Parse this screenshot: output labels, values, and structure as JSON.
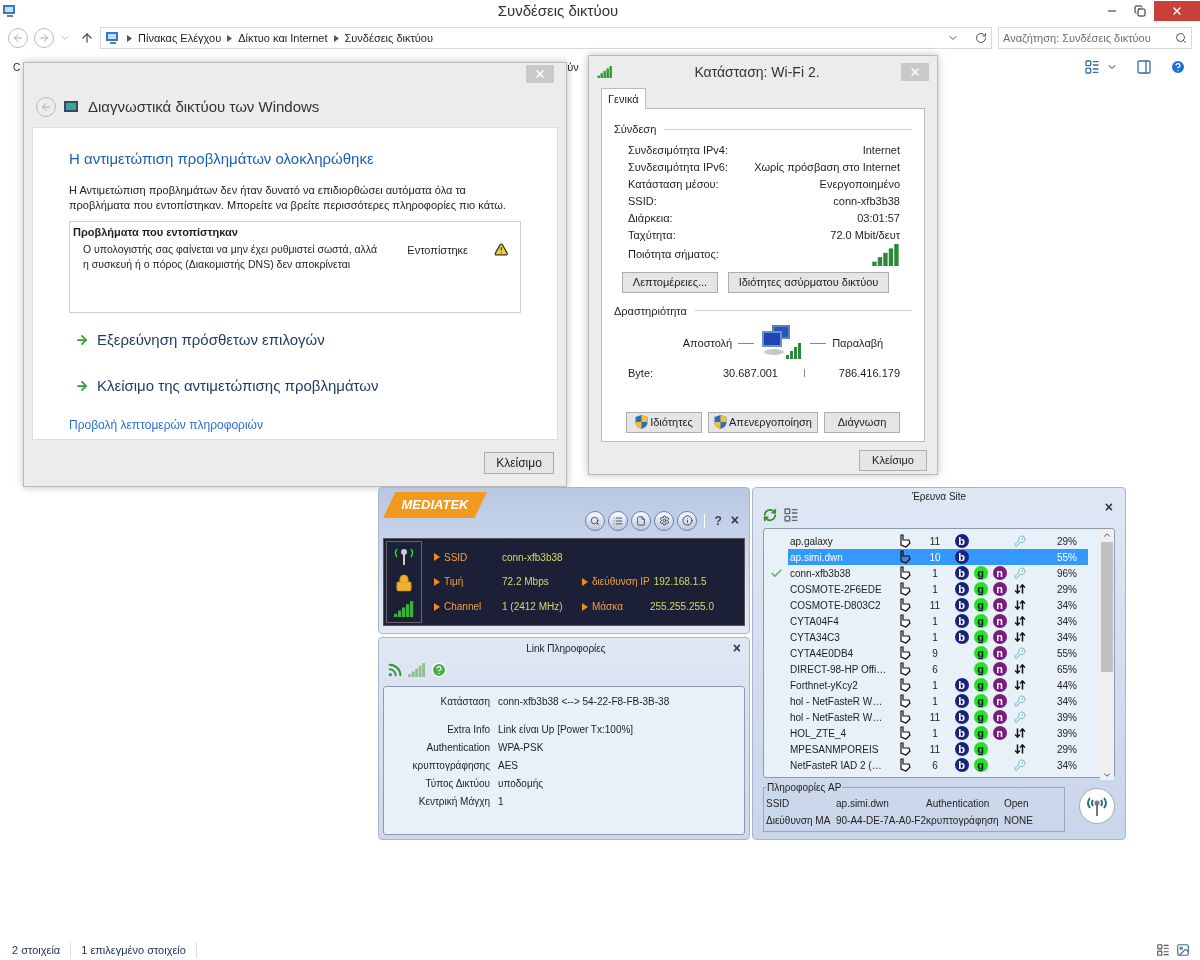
{
  "explorer": {
    "title": "Συνδέσεις δικτύου",
    "breadcrumb": [
      "Πίνακας Ελέγχου",
      "Δίκτυο και Internet",
      "Συνδέσεις δικτύου"
    ],
    "search_placeholder": "Αναζήτηση: Συνδέσεις δικτύου",
    "toolbar_fragments": [
      "C",
      "ύν"
    ],
    "status_bar": [
      "2 στοιχεία",
      "1 επιλεγμένο στοιχείο"
    ]
  },
  "diagnostics": {
    "title": "Διαγνωστικά δικτύου των Windows",
    "heading": "Η αντιμετώπιση προβλημάτων ολοκληρώθηκε",
    "message": "Η Αντιμετώπιση προβλημάτων δεν ήταν δυνατό να επιδιορθώσει αυτόματα όλα τα προβλήματα που εντοπίστηκαν. Μπορείτε να βρείτε περισσότερες πληροφορίες πιο κάτω.",
    "problems": {
      "title": "Προβλήματα που εντοπίστηκαν",
      "items": [
        {
          "text": "Ο υπολογιστής σας φαίνεται να μην έχει ρυθμιστεί σωστά, αλλά η συσκευή ή ο πόρος (Διακομιστής DNS) δεν αποκρίνεται",
          "status": "Εντοπίστηκε"
        }
      ]
    },
    "options": [
      "Εξερεύνηση πρόσθετων επιλογών",
      "Κλείσιμο της αντιμετώπισης προβλημάτων"
    ],
    "details_link": "Προβολή λεπτομερών πληροφοριών",
    "close_button": "Κλείσιμο"
  },
  "wifi_status": {
    "title": "Κατάσταση: Wi-Fi 2.",
    "tabs": [
      {
        "label": "Γενικά",
        "selected": true
      }
    ],
    "connection": {
      "title": "Σύνδεση",
      "rows": [
        {
          "label": "Συνδεσιμότητα IPv4:",
          "value": "Internet"
        },
        {
          "label": "Συνδεσιμότητα IPv6:",
          "value": "Χωρίς πρόσβαση στο Internet"
        },
        {
          "label": "Κατάσταση μέσου:",
          "value": "Ενεργοποιημένο"
        },
        {
          "label": "SSID:",
          "value": "conn-xfb3b38"
        },
        {
          "label": "Διάρκεια:",
          "value": "03:01:57"
        },
        {
          "label": "Ταχύτητα:",
          "value": "72.0 Mbit/δευτ"
        }
      ],
      "signal_label": "Ποιότητα σήματος:"
    },
    "buttons": [
      "Λεπτομέρειες...",
      "Ιδιότητες ασύρματου δικτύου"
    ],
    "activity": {
      "title": "Δραστηριότητα",
      "sent_label": "Αποστολή",
      "received_label": "Παραλαβή",
      "bytes_label": "Byte:",
      "sent": "30.687.001",
      "received": "786.416.179"
    },
    "action_buttons": [
      {
        "label": "Ιδιότητες",
        "shield": true
      },
      {
        "label": "Απενεργοποίηση",
        "shield": true
      },
      {
        "label": "Διάγνωση",
        "shield": false
      }
    ],
    "close_button": "Κλείσιμο"
  },
  "mediatek": {
    "logo": "MEDIATEK",
    "help": "?",
    "close": "×",
    "fields": [
      {
        "label": "SSID",
        "value": "conn-xfb3b38"
      },
      {
        "label": "Τιμή",
        "value": "72.2 Mbps"
      },
      {
        "label": "Channel",
        "value": "1 (2412 MHz)"
      },
      {
        "label": "διεύθυνση IP",
        "value": "192.168.1.5"
      },
      {
        "label": "Μάσκα",
        "value": "255.255.255.0"
      }
    ]
  },
  "link_info": {
    "title": "Link Πληροφορίες",
    "close": "×",
    "rows": [
      {
        "label": "Κατάσταση",
        "value": "conn-xfb3b38 <--> 54-22-F8-FB-3B-38"
      },
      {
        "label": "Extra Info",
        "value": "Link είναι Up  [Power Tx:100%]"
      },
      {
        "label": "Authentication",
        "value": "WPA-PSK"
      },
      {
        "label": "κρυπτογράφησης",
        "value": "AES"
      },
      {
        "label": "Τύπος Δικτύου",
        "value": "υποδομής"
      },
      {
        "label": "Κεντρική Μάγχη",
        "value": "1"
      }
    ]
  },
  "site_survey": {
    "title": "Έρευνα Site",
    "close": "×",
    "rows": [
      {
        "name": "ap.galaxy",
        "channel": "11",
        "b": "b",
        "security": {
          "kind": "key"
        },
        "signal": "29%",
        "selected": false,
        "connected": false
      },
      {
        "name": "ap.simi.dwn",
        "channel": "10",
        "b": "b",
        "signal": "55%",
        "selected": true,
        "connected": false
      },
      {
        "name": "conn-xfb3b38",
        "channel": "1",
        "b": "b",
        "g": "g",
        "n": "n",
        "security": {
          "kind": "key"
        },
        "signal": "96%",
        "selected": false,
        "connected": true
      },
      {
        "name": "COSMOTE-2F6EDE",
        "channel": "1",
        "b": "b",
        "g": "g",
        "n": "n",
        "security": {
          "kind": "wpa"
        },
        "signal": "29%",
        "selected": false,
        "connected": false
      },
      {
        "name": "COSMOTE-D803C2",
        "channel": "11",
        "b": "b",
        "g": "g",
        "n": "n",
        "security": {
          "kind": "wpa"
        },
        "signal": "34%",
        "selected": false,
        "connected": false
      },
      {
        "name": "CYTA04F4",
        "channel": "1",
        "b": "b",
        "g": "g",
        "n": "n",
        "security": {
          "kind": "wpa"
        },
        "signal": "34%",
        "selected": false,
        "connected": false
      },
      {
        "name": "CYTA34C3",
        "channel": "1",
        "b": "b",
        "g": "g",
        "n": "n",
        "security": {
          "kind": "wpa"
        },
        "signal": "34%",
        "selected": false,
        "connected": false
      },
      {
        "name": "CYTA4E0DB4",
        "channel": "9",
        "g": "g",
        "n": "n",
        "security": {
          "kind": "key"
        },
        "signal": "55%",
        "selected": false,
        "connected": false
      },
      {
        "name": "DIRECT-98-HP Offi…",
        "channel": "6",
        "g": "g",
        "n": "n",
        "security": {
          "kind": "wpa"
        },
        "signal": "65%",
        "selected": false,
        "connected": false
      },
      {
        "name": "Forthnet-yKcy2",
        "channel": "1",
        "b": "b",
        "g": "g",
        "n": "n",
        "security": {
          "kind": "wpa"
        },
        "signal": "44%",
        "selected": false,
        "connected": false
      },
      {
        "name": "hol - NetFasteR W…",
        "channel": "1",
        "b": "b",
        "g": "g",
        "n": "n",
        "security": {
          "kind": "key"
        },
        "signal": "34%",
        "selected": false,
        "connected": false
      },
      {
        "name": "hol - NetFasteR W…",
        "channel": "11",
        "b": "b",
        "g": "g",
        "n": "n",
        "security": {
          "kind": "key"
        },
        "signal": "39%",
        "selected": false,
        "connected": false
      },
      {
        "name": "HOL_ZTE_4",
        "channel": "1",
        "b": "b",
        "g": "g",
        "n": "n",
        "security": {
          "kind": "wpa"
        },
        "signal": "39%",
        "selected": false,
        "connected": false
      },
      {
        "name": "MPESANMPOREIS",
        "channel": "11",
        "b": "b",
        "g": "g",
        "security": {
          "kind": "wpa"
        },
        "signal": "29%",
        "selected": false,
        "connected": false
      },
      {
        "name": "NetFasteR IAD 2 (…",
        "channel": "6",
        "b": "b",
        "g": "g",
        "security": {
          "kind": "key"
        },
        "signal": "34%",
        "selected": false,
        "connected": false
      }
    ],
    "ap_info": {
      "title": "Πληροφορίες AP",
      "fields": [
        {
          "label": "SSID",
          "value": "ap.simi.dwn"
        },
        {
          "label": "Authentication",
          "value": "Open"
        },
        {
          "label": "Διεύθυνση MA",
          "value": "90-A4-DE-7A-A0-F2"
        },
        {
          "label": "κρυπτογράφηση",
          "value": "NONE"
        }
      ]
    }
  }
}
